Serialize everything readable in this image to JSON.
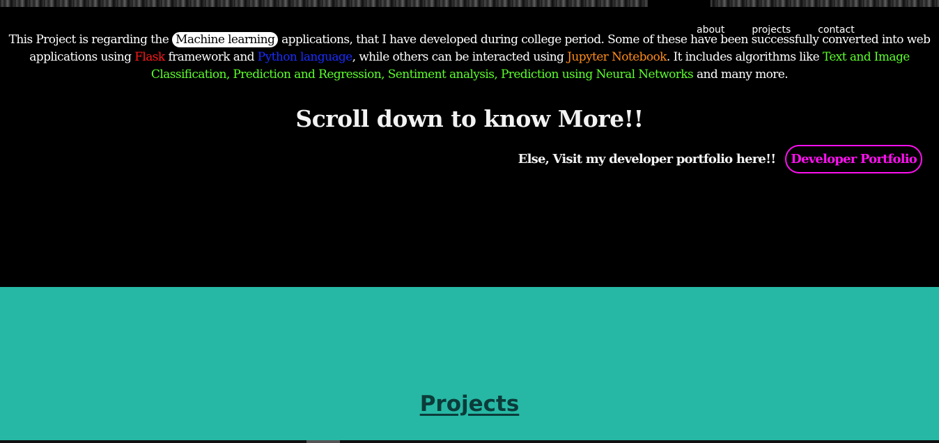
{
  "nav": {
    "about": "about",
    "projects": "projects",
    "contact": "contact"
  },
  "intro": {
    "t1": "This Project is regarding the ",
    "highlight": "Machine learning",
    "t2": " applications, that I have developed during college period. Some of these have been successfully converted into web applications using ",
    "flask": "Flask",
    "t3": " framework and ",
    "python": "Python language",
    "t4": ", while others can be interacted using ",
    "jupyter": "Jupyter Notebook",
    "t5": ". It includes algorithms like ",
    "algorithms": "Text and Image Classification, Prediction and Regression, Sentiment analysis, Prediction using Neural Networks",
    "t6": " and many more."
  },
  "scroll_title": "Scroll down to know More!!",
  "portfolio": {
    "prompt": "Else, Visit my developer portfolio here!!",
    "button_label": "Developer Portfolio"
  },
  "projects_section": {
    "heading": "Projects"
  },
  "colors": {
    "hero_bg": "#000000",
    "section_bg": "#26b8a4",
    "flask": "#ff1a1a",
    "python": "#1a2cff",
    "jupyter": "#ff8c1a",
    "algorithms": "#5cff2b",
    "portfolio_accent": "#ff10f0"
  }
}
